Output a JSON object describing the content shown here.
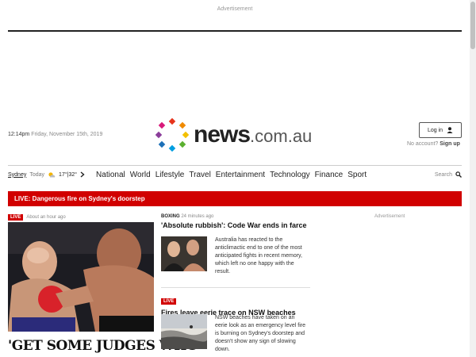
{
  "ads": {
    "top_label": "Advertisement",
    "side_label": "Advertisement"
  },
  "header": {
    "time": "12:14pm",
    "date": "Friday, November 15th, 2019",
    "logo_main": "news",
    "logo_suffix": ".com.au",
    "login_label": "Log in",
    "no_account_text": "No account?",
    "signup_label": "Sign up"
  },
  "weather": {
    "city": "Sydney",
    "day": "Today",
    "temp": "17°|32°"
  },
  "nav": {
    "items": [
      "National",
      "World",
      "Lifestyle",
      "Travel",
      "Entertainment",
      "Technology",
      "Finance",
      "Sport"
    ],
    "search_label": "Search"
  },
  "breaking": {
    "text": "LIVE: Dangerous fire on Sydney's doorstep"
  },
  "lead": {
    "badge": "LIVE",
    "time": "About an hour ago",
    "headline": "'GET SOME JUDGES WHO"
  },
  "stories": [
    {
      "category": "BOXING",
      "time": "24 minutes ago",
      "headline": "'Absolute rubbish': Code War ends in farce",
      "description": "Australia has reacted to the anticlimactic end to one of the most anticipated fights in recent memory, which left no one happy with the result."
    },
    {
      "badge": "LIVE",
      "headline": "Fires leave eerie trace on NSW beaches",
      "description": "NSW beaches have taken on an eerie look as an emergency level fire is burning on Sydney's doorstep and doesn't show any sign of slowing down."
    }
  ],
  "colors": {
    "brand_red": "#d10000",
    "text": "#222222"
  }
}
